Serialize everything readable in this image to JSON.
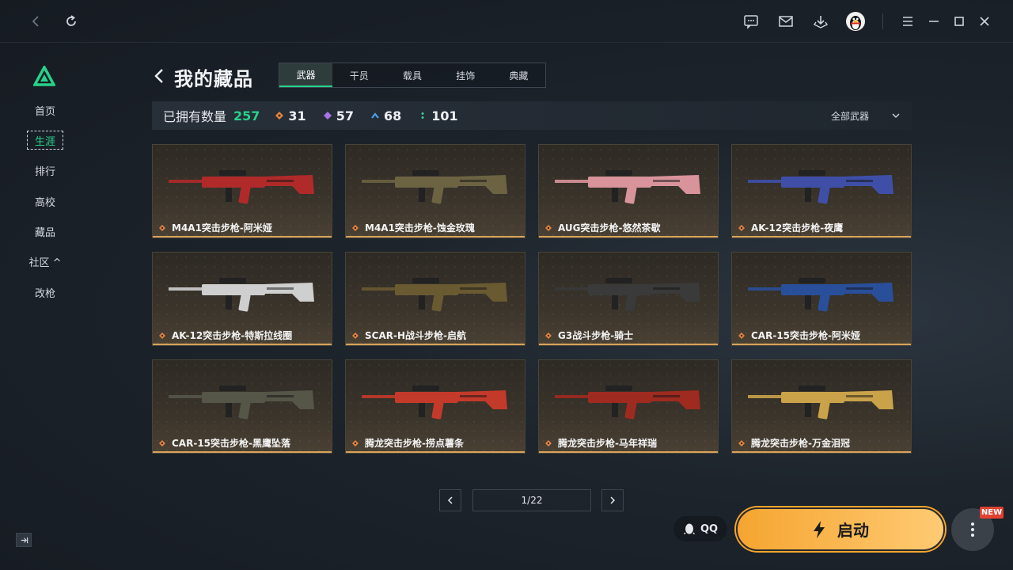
{
  "app": {
    "accent": "#26d38a",
    "launch_color": "#f5a530"
  },
  "nav": {
    "items": [
      {
        "label": "首页"
      },
      {
        "label": "生涯"
      },
      {
        "label": "排行"
      },
      {
        "label": "高校"
      },
      {
        "label": "藏品"
      },
      {
        "label": "社区 ^"
      },
      {
        "label": "改枪"
      }
    ],
    "active_index": 1
  },
  "header": {
    "title": "我的藏品",
    "tabs": [
      {
        "label": "武器"
      },
      {
        "label": "干员"
      },
      {
        "label": "载具"
      },
      {
        "label": "挂饰"
      },
      {
        "label": "典藏"
      }
    ],
    "active_tab": 0
  },
  "stats": {
    "owned_label": "已拥有数量",
    "owned_count": "257",
    "rarities": [
      {
        "count": "31",
        "color": "#e8833a",
        "icon": "orange-diamond-icon"
      },
      {
        "count": "57",
        "color": "#a872e8",
        "icon": "purple-diamond-icon"
      },
      {
        "count": "68",
        "color": "#4aa3e8",
        "icon": "blue-chevron-icon"
      },
      {
        "count": "101",
        "color": "#3fd19a",
        "icon": "green-dots-icon"
      }
    ],
    "filter_label": "全部武器"
  },
  "weapons": [
    {
      "name": "M4A1突击步枪-阿米娅",
      "color": "#b02a2a"
    },
    {
      "name": "M4A1突击步枪-蚀金玫瑰",
      "color": "#6b6342"
    },
    {
      "name": "AUG突击步枪-悠然茶歇",
      "color": "#d9939a"
    },
    {
      "name": "AK-12突击步枪-夜鹰",
      "color": "#3f4fa8"
    },
    {
      "name": "AK-12突击步枪-特斯拉线圈",
      "color": "#cfcfcf"
    },
    {
      "name": "SCAR-H战斗步枪-启航",
      "color": "#6a5a32"
    },
    {
      "name": "G3战斗步枪-骑士",
      "color": "#3a3a3a"
    },
    {
      "name": "CAR-15突击步枪-阿米娅",
      "color": "#2a4f9a"
    },
    {
      "name": "CAR-15突击步枪-黑鹰坠落",
      "color": "#555548"
    },
    {
      "name": "腾龙突击步枪-捞点薯条",
      "color": "#c43a2a"
    },
    {
      "name": "腾龙突击步枪-马年祥瑞",
      "color": "#9e2a20"
    },
    {
      "name": "腾龙突击步枪-万金泪冠",
      "color": "#c9a24a"
    }
  ],
  "pagination": {
    "page_text": "1/22"
  },
  "bottom": {
    "qq_label": "QQ",
    "launch_label": "启动",
    "new_badge": "NEW"
  }
}
